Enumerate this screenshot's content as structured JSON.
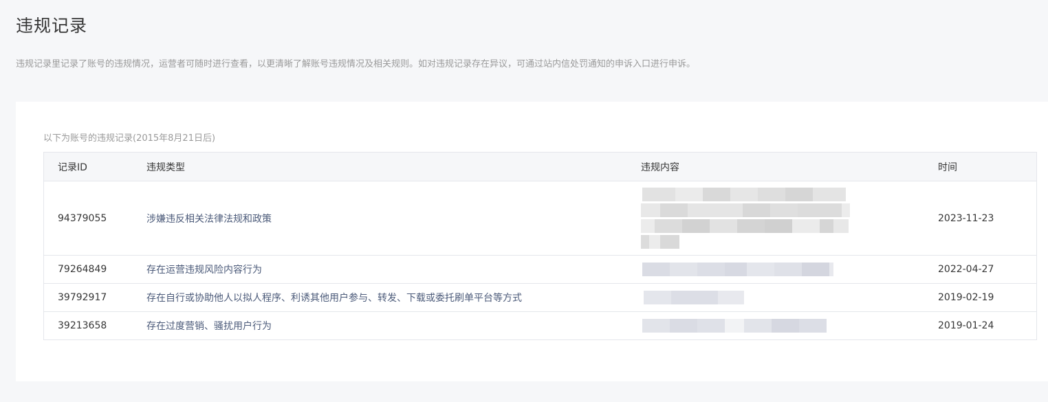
{
  "page": {
    "title": "违规记录",
    "description": "违规记录里记录了账号的违规情况，运营者可随时进行查看，以更清晰了解账号违规情况及相关规则。如对违规记录存在异议，可通过站内信处罚通知的申诉入口进行申诉。"
  },
  "table": {
    "caption": "以下为账号的违规记录(2015年8月21日后)",
    "headers": {
      "id": "记录ID",
      "type": "违规类型",
      "content": "违规内容",
      "time": "时间"
    },
    "rows": [
      {
        "id": "94379055",
        "type": "涉嫌违反相关法律法规和政策",
        "time": "2023-11-23"
      },
      {
        "id": "79264849",
        "type": "存在运营违规风险内容行为",
        "time": "2022-04-27"
      },
      {
        "id": "39792917",
        "type": "存在自行或协助他人以拟人程序、利诱其他用户参与、转发、下载或委托刷单平台等方式",
        "time": "2019-02-19"
      },
      {
        "id": "39213658",
        "type": "存在过度营销、骚扰用户行为",
        "time": "2019-01-24"
      }
    ]
  },
  "colors": {
    "background": "#f6f7f9",
    "card": "#ffffff",
    "border": "#e4e6eb",
    "link_text": "#4b5a79",
    "muted_text": "#9a9a9a"
  }
}
